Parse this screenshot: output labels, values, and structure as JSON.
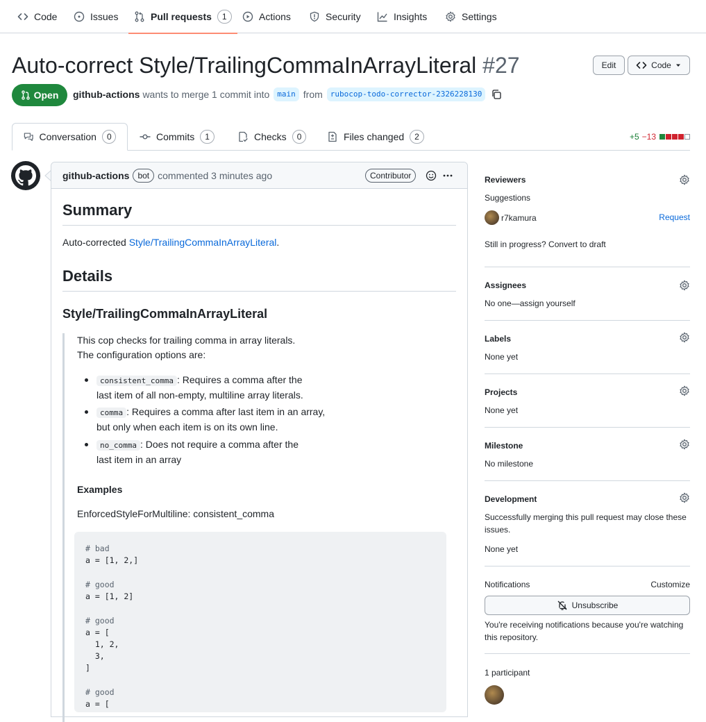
{
  "repo_nav": {
    "code": "Code",
    "issues": "Issues",
    "pull_requests": "Pull requests",
    "pull_requests_count": "1",
    "actions": "Actions",
    "security": "Security",
    "insights": "Insights",
    "settings": "Settings"
  },
  "pr": {
    "title": "Auto-correct Style/TrailingCommaInArrayLiteral",
    "number": "#27",
    "edit_label": "Edit",
    "code_label": "Code",
    "state": "Open",
    "author": "github-actions",
    "merge_text_1": "wants to merge 1 commit into",
    "base_branch": "main",
    "merge_text_2": "from",
    "head_branch": "rubocop-todo-corrector-2326228130"
  },
  "pr_tabs": {
    "conversation": "Conversation",
    "conversation_count": "0",
    "commits": "Commits",
    "commits_count": "1",
    "checks": "Checks",
    "checks_count": "0",
    "files_changed": "Files changed",
    "files_changed_count": "2",
    "additions": "+5",
    "deletions": "−13"
  },
  "comment": {
    "author": "github-actions",
    "bot_badge": "bot",
    "commented": "commented 3 minutes ago",
    "role_badge": "Contributor",
    "summary_heading": "Summary",
    "summary_prefix": "Auto-corrected ",
    "summary_link": "Style/TrailingCommaInArrayLiteral",
    "summary_suffix": ".",
    "details_heading": "Details",
    "cop_heading": "Style/TrailingCommaInArrayLiteral",
    "quote": {
      "line1": "This cop checks for trailing comma in array literals.",
      "line2": "The configuration options are:",
      "b1_code": "consistent_comma",
      "b1_text_a": ": Requires a comma after the",
      "b1_text_b": "last item of all non-empty, multiline array literals.",
      "b2_code": "comma",
      "b2_text_a": ": Requires a comma after last item in an array,",
      "b2_text_b": "but only when each item is on its own line.",
      "b3_code": "no_comma",
      "b3_text_a": ": Does not require a comma after the",
      "b3_text_b": "last item in an array",
      "examples": "Examples",
      "enforced": "EnforcedStyleForMultiline: consistent_comma"
    },
    "code_lines": [
      "# bad",
      "a = [1, 2,]",
      "",
      "# good",
      "a = [1, 2]",
      "",
      "# good",
      "a = [",
      "  1, 2,",
      "  3,",
      "]",
      "",
      "# good",
      "a = ["
    ]
  },
  "sidebar": {
    "reviewers": "Reviewers",
    "suggestions": "Suggestions",
    "suggested_user": "r7kamura",
    "request": "Request",
    "draft_text": "Still in progress? Convert to draft",
    "assignees": "Assignees",
    "assignees_value": "No one—assign yourself",
    "labels": "Labels",
    "labels_value": "None yet",
    "projects": "Projects",
    "projects_value": "None yet",
    "milestone": "Milestone",
    "milestone_value": "No milestone",
    "development": "Development",
    "development_text": "Successfully merging this pull request may close these issues.",
    "development_value": "None yet",
    "notifications": "Notifications",
    "customize": "Customize",
    "unsubscribe": "Unsubscribe",
    "notifications_text": "You're receiving notifications because you're watching this repository.",
    "participants": "1 participant"
  },
  "colors": {
    "open_green": "#1f883d",
    "link_blue": "#0969da",
    "nav_underline": "#fd8c73"
  }
}
